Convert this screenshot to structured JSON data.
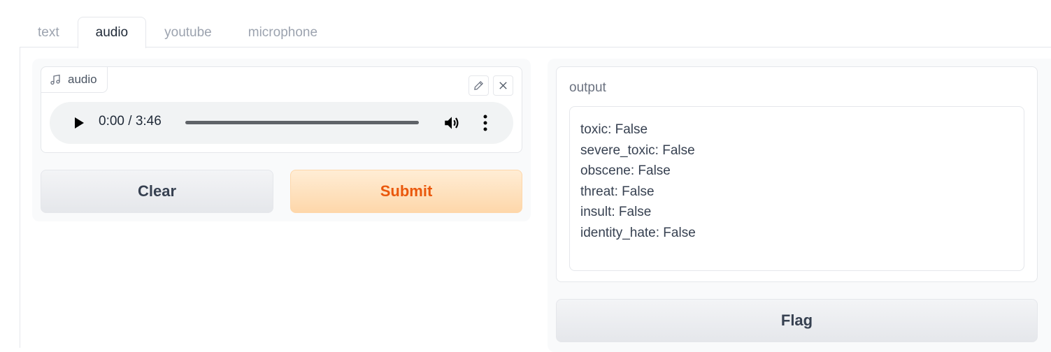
{
  "tabs": [
    {
      "label": "text",
      "active": false
    },
    {
      "label": "audio",
      "active": true
    },
    {
      "label": "youtube",
      "active": false
    },
    {
      "label": "microphone",
      "active": false
    }
  ],
  "input": {
    "label": "audio",
    "label_icon": "music-note-icon",
    "edit_icon": "pencil-icon",
    "close_icon": "close-icon",
    "player": {
      "time": "0:00 / 3:46",
      "progress": 0,
      "play_icon": "play-icon",
      "volume_icon": "volume-icon",
      "more_icon": "more-vertical-icon"
    }
  },
  "buttons": {
    "clear": "Clear",
    "submit": "Submit",
    "flag": "Flag"
  },
  "output": {
    "label": "output",
    "lines": [
      "toxic: False",
      "severe_toxic: False",
      "obscene: False",
      "threat: False",
      "insult: False",
      "identity_hate: False"
    ]
  },
  "colors": {
    "accent": "#ea580c",
    "submit_bg": "#fed7aa",
    "secondary_bg": "#e5e7eb"
  }
}
